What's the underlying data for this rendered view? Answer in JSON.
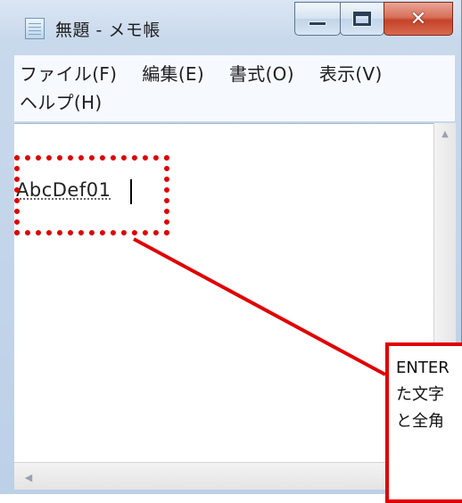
{
  "window": {
    "title": "無題 - メモ帳",
    "caption_buttons": {
      "minimize": "minimize",
      "maximize": "maximize",
      "close": "✕"
    }
  },
  "menu": {
    "items": [
      {
        "label": "ファイル(F)"
      },
      {
        "label": "編集(E)"
      },
      {
        "label": "書式(O)"
      },
      {
        "label": "表示(V)"
      },
      {
        "label": "ヘルプ(H)"
      }
    ]
  },
  "editor": {
    "content": "AbcDef01"
  },
  "annotation": {
    "callout_lines": [
      "ENTER",
      "た文字",
      "と全角"
    ],
    "color": "#e00000"
  },
  "scrollbars": {
    "up_arrow": "▲",
    "left_arrow": "◀"
  }
}
